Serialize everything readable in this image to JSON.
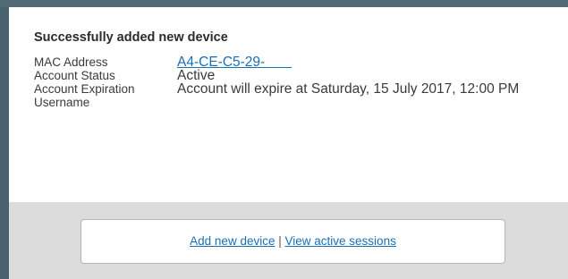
{
  "confirmation": {
    "title": "Successfully added new device",
    "fields": [
      {
        "label": "MAC Address",
        "value": "A4-CE-C5-29-"
      },
      {
        "label": "Account Status",
        "value": "Active"
      },
      {
        "label": "Account Expiration",
        "value": "Account will expire at Saturday, 15 July 2017, 12:00 PM"
      },
      {
        "label": "Username",
        "value": ""
      }
    ]
  },
  "actions": {
    "add_device": "Add new device",
    "separator": "|",
    "view_sessions": "View active sessions"
  },
  "colors": {
    "link": "#1a6fb5",
    "panel_bg": "#dcdcdc",
    "frame": "#4a6270"
  }
}
